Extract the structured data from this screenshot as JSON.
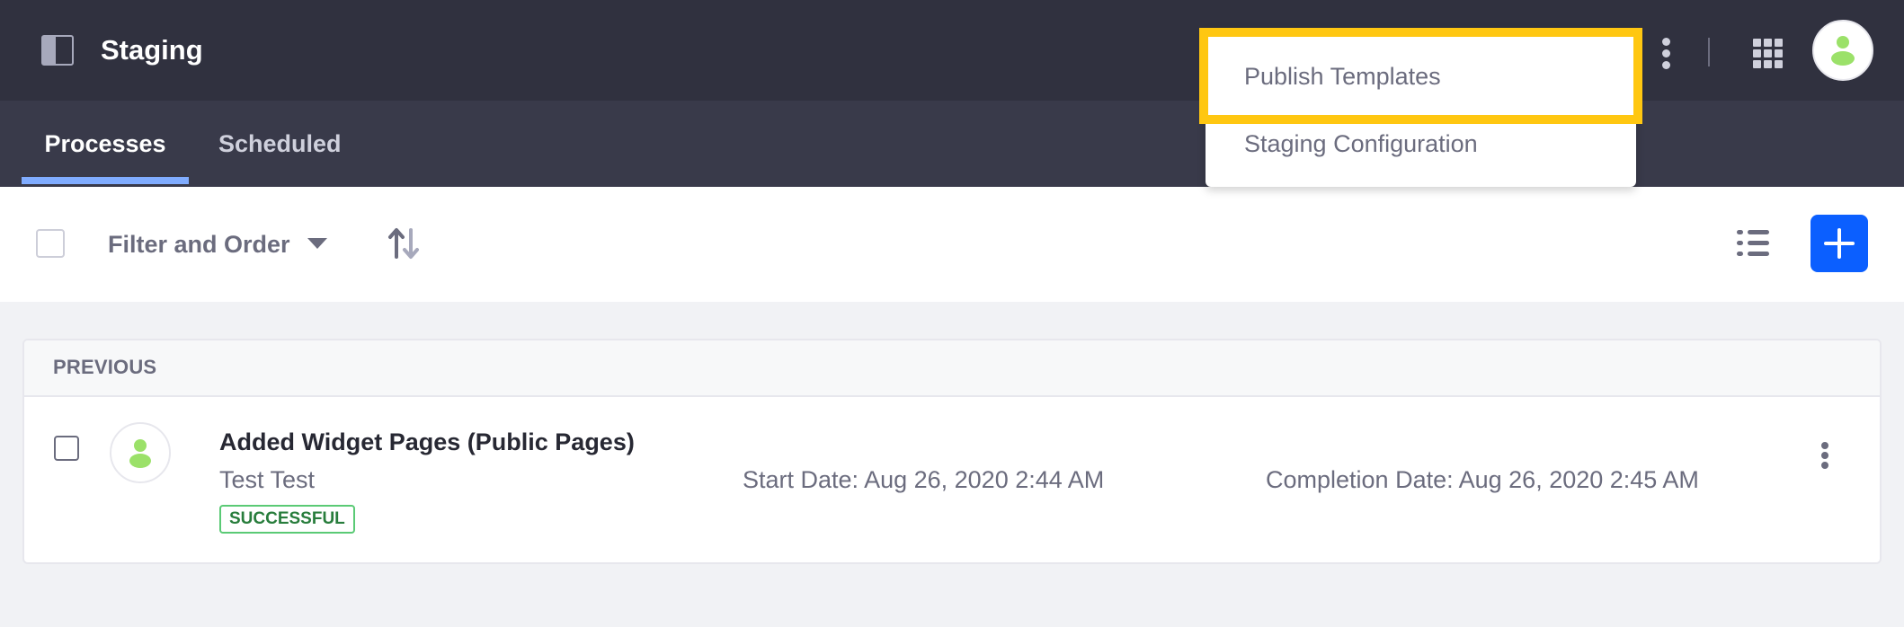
{
  "header": {
    "title": "Staging",
    "icons": {
      "sidebar_toggle": "sidebar-toggle-icon",
      "options": "kebab-vertical-icon",
      "apps": "apps-grid-icon",
      "user": "user-avatar-icon"
    }
  },
  "nav": {
    "tabs": [
      {
        "label": "Processes",
        "active": true
      },
      {
        "label": "Scheduled",
        "active": false
      }
    ]
  },
  "toolbar": {
    "filter_label": "Filter and Order",
    "icons": {
      "caret": "caret-down-icon",
      "sort": "order-arrows-icon",
      "display": "list-view-icon",
      "add": "plus-icon"
    },
    "add_button_color": "#0b5fff"
  },
  "dropdown": {
    "items": [
      {
        "label": "Publish Templates",
        "highlighted": true
      },
      {
        "label": "Staging Configuration",
        "highlighted": false
      }
    ],
    "highlight_color": "#ffc711"
  },
  "list": {
    "section_header": "PREVIOUS",
    "rows": [
      {
        "title": "Added Widget Pages (Public Pages)",
        "user": "Test Test",
        "status": "SUCCESSFUL",
        "start_date": "Start Date: Aug 26, 2020 2:44 AM",
        "completion_date": "Completion Date: Aug 26, 2020 2:45 AM"
      }
    ]
  },
  "colors": {
    "header_bg": "#30313f",
    "nav_bg": "#393a4a",
    "tab_active_underline": "#80acff",
    "avatar_green": "#9be169",
    "success_border": "#5aca75",
    "success_text": "#287d3c"
  }
}
